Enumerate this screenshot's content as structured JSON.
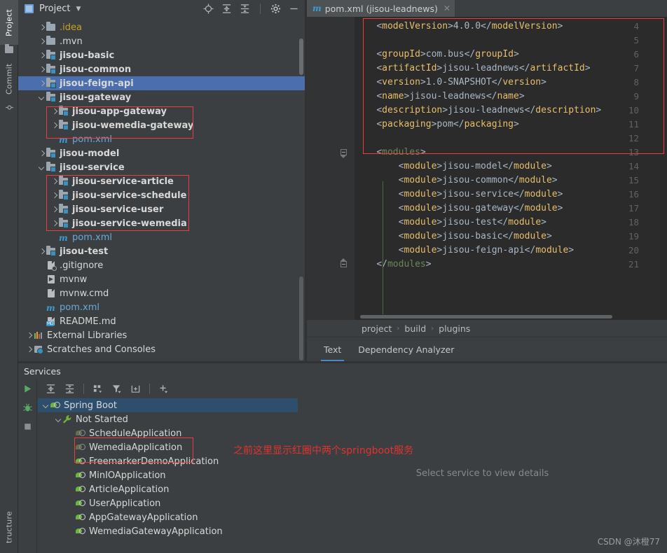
{
  "window": {
    "left_tabs": [
      {
        "label": "Project",
        "icon": "project-icon",
        "selected": true
      },
      {
        "label": "Commit",
        "icon": "commit-icon",
        "selected": false
      },
      {
        "label": "tructure",
        "icon": "structure-icon",
        "selected": false
      }
    ]
  },
  "project_panel": {
    "title": "Project",
    "dropdown_icon": "chevron-down-icon",
    "toolbar_icons": [
      "locate-icon",
      "expand-all-icon",
      "collapse-all-icon",
      "settings-gear-icon",
      "minimize-icon"
    ],
    "tree": [
      {
        "label": ".idea",
        "indent": 1,
        "arrow": "right",
        "icon": "folder-icon",
        "style": "yellow"
      },
      {
        "label": ".mvn",
        "indent": 1,
        "arrow": "right",
        "icon": "folder-icon",
        "style": "plain"
      },
      {
        "label": "jisou-basic",
        "indent": 1,
        "arrow": "right",
        "icon": "module-folder-icon",
        "style": "bold"
      },
      {
        "label": "jisou-common",
        "indent": 1,
        "arrow": "right",
        "icon": "module-folder-icon",
        "style": "bold"
      },
      {
        "label": "jisou-feign-api",
        "indent": 1,
        "arrow": "right",
        "icon": "module-folder-icon",
        "style": "bold",
        "selected": true
      },
      {
        "label": "jisou-gateway",
        "indent": 1,
        "arrow": "down",
        "icon": "module-folder-icon",
        "style": "bold"
      },
      {
        "label": "jisou-app-gateway",
        "indent": 2,
        "arrow": "right",
        "icon": "module-folder-icon",
        "style": "bold"
      },
      {
        "label": "jisou-wemedia-gateway",
        "indent": 2,
        "arrow": "right",
        "icon": "module-folder-icon",
        "style": "bold"
      },
      {
        "label": "pom.xml",
        "indent": 2,
        "arrow": "none",
        "icon": "maven-icon",
        "style": "plain"
      },
      {
        "label": "jisou-model",
        "indent": 1,
        "arrow": "right",
        "icon": "module-folder-icon",
        "style": "bold"
      },
      {
        "label": "jisou-service",
        "indent": 1,
        "arrow": "down",
        "icon": "module-folder-icon",
        "style": "bold"
      },
      {
        "label": "jisou-service-article",
        "indent": 2,
        "arrow": "right",
        "icon": "module-folder-icon",
        "style": "bold"
      },
      {
        "label": "jisou-service-schedule",
        "indent": 2,
        "arrow": "right",
        "icon": "module-folder-icon",
        "style": "bold"
      },
      {
        "label": "jisou-service-user",
        "indent": 2,
        "arrow": "right",
        "icon": "module-folder-icon",
        "style": "bold"
      },
      {
        "label": "jisou-service-wemedia",
        "indent": 2,
        "arrow": "right",
        "icon": "module-folder-icon",
        "style": "bold"
      },
      {
        "label": "pom.xml",
        "indent": 2,
        "arrow": "none",
        "icon": "maven-icon",
        "style": "plain"
      },
      {
        "label": "jisou-test",
        "indent": 1,
        "arrow": "right",
        "icon": "module-folder-icon",
        "style": "bold"
      },
      {
        "label": ".gitignore",
        "indent": 1,
        "arrow": "none",
        "icon": "gitignore-file-icon",
        "style": "plain"
      },
      {
        "label": "mvnw",
        "indent": 1,
        "arrow": "none",
        "icon": "executable-file-icon",
        "style": "plain"
      },
      {
        "label": "mvnw.cmd",
        "indent": 1,
        "arrow": "none",
        "icon": "text-file-icon",
        "style": "plain"
      },
      {
        "label": "pom.xml",
        "indent": 1,
        "arrow": "none",
        "icon": "maven-icon",
        "style": "plain"
      },
      {
        "label": "README.md",
        "indent": 1,
        "arrow": "none",
        "icon": "markdown-file-icon",
        "style": "plain"
      },
      {
        "label": "External Libraries",
        "indent": 0,
        "arrow": "right",
        "icon": "libraries-icon",
        "style": "plain"
      },
      {
        "label": "Scratches and Consoles",
        "indent": 0,
        "arrow": "right",
        "icon": "scratches-icon",
        "style": "plain"
      }
    ]
  },
  "editor": {
    "tab": {
      "label": "pom.xml (jisou-leadnews)",
      "icon": "maven-icon",
      "close_icon": "close-icon"
    },
    "lines": [
      {
        "n": "4",
        "indent": 4,
        "parts": [
          {
            "t": "<",
            "c": "brk"
          },
          {
            "t": "modelVersion",
            "c": "tag"
          },
          {
            "t": ">",
            "c": "brk"
          },
          {
            "t": "4.0.0",
            "c": "txt"
          },
          {
            "t": "</",
            "c": "brk"
          },
          {
            "t": "modelVersion",
            "c": "tag"
          },
          {
            "t": ">",
            "c": "brk"
          }
        ]
      },
      {
        "n": "5",
        "indent": 4,
        "parts": []
      },
      {
        "n": "6",
        "indent": 4,
        "parts": [
          {
            "t": "<",
            "c": "brk"
          },
          {
            "t": "groupId",
            "c": "tag"
          },
          {
            "t": ">",
            "c": "brk"
          },
          {
            "t": "com.bus",
            "c": "txt"
          },
          {
            "t": "</",
            "c": "brk"
          },
          {
            "t": "groupId",
            "c": "tag"
          },
          {
            "t": ">",
            "c": "brk"
          }
        ]
      },
      {
        "n": "7",
        "indent": 4,
        "parts": [
          {
            "t": "<",
            "c": "brk"
          },
          {
            "t": "artifactId",
            "c": "tag"
          },
          {
            "t": ">",
            "c": "brk"
          },
          {
            "t": "jisou-leadnews",
            "c": "txt"
          },
          {
            "t": "</",
            "c": "brk"
          },
          {
            "t": "artifactId",
            "c": "tag"
          },
          {
            "t": ">",
            "c": "brk"
          }
        ]
      },
      {
        "n": "8",
        "indent": 4,
        "parts": [
          {
            "t": "<",
            "c": "brk"
          },
          {
            "t": "version",
            "c": "tag"
          },
          {
            "t": ">",
            "c": "brk"
          },
          {
            "t": "1.0-SNAPSHOT",
            "c": "txt"
          },
          {
            "t": "</",
            "c": "brk"
          },
          {
            "t": "version",
            "c": "tag"
          },
          {
            "t": ">",
            "c": "brk"
          }
        ]
      },
      {
        "n": "9",
        "indent": 4,
        "parts": [
          {
            "t": "<",
            "c": "brk"
          },
          {
            "t": "name",
            "c": "tag"
          },
          {
            "t": ">",
            "c": "brk"
          },
          {
            "t": "jisou-leadnews",
            "c": "txt"
          },
          {
            "t": "</",
            "c": "brk"
          },
          {
            "t": "name",
            "c": "tag"
          },
          {
            "t": ">",
            "c": "brk"
          }
        ]
      },
      {
        "n": "10",
        "indent": 4,
        "parts": [
          {
            "t": "<",
            "c": "brk"
          },
          {
            "t": "description",
            "c": "tag"
          },
          {
            "t": ">",
            "c": "brk"
          },
          {
            "t": "jisou-leadnews",
            "c": "txt"
          },
          {
            "t": "</",
            "c": "brk"
          },
          {
            "t": "description",
            "c": "tag"
          },
          {
            "t": ">",
            "c": "brk"
          }
        ]
      },
      {
        "n": "11",
        "indent": 4,
        "parts": [
          {
            "t": "<",
            "c": "brk"
          },
          {
            "t": "packaging",
            "c": "tag"
          },
          {
            "t": ">",
            "c": "brk"
          },
          {
            "t": "pom",
            "c": "txt"
          },
          {
            "t": "</",
            "c": "brk"
          },
          {
            "t": "packaging",
            "c": "tag"
          },
          {
            "t": ">",
            "c": "brk"
          }
        ]
      },
      {
        "n": "12",
        "indent": 4,
        "parts": []
      },
      {
        "n": "13",
        "indent": 4,
        "fold": "down",
        "parts": [
          {
            "t": "<",
            "c": "brk"
          },
          {
            "t": "modules",
            "c": "green"
          },
          {
            "t": ">",
            "c": "brk"
          }
        ]
      },
      {
        "n": "14",
        "indent": 8,
        "parts": [
          {
            "t": "<",
            "c": "brk"
          },
          {
            "t": "module",
            "c": "tag"
          },
          {
            "t": ">",
            "c": "brk"
          },
          {
            "t": "jisou-model",
            "c": "txt"
          },
          {
            "t": "</",
            "c": "brk"
          },
          {
            "t": "module",
            "c": "tag"
          },
          {
            "t": ">",
            "c": "brk"
          }
        ]
      },
      {
        "n": "15",
        "indent": 8,
        "parts": [
          {
            "t": "<",
            "c": "brk"
          },
          {
            "t": "module",
            "c": "tag"
          },
          {
            "t": ">",
            "c": "brk"
          },
          {
            "t": "jisou-common",
            "c": "txt"
          },
          {
            "t": "</",
            "c": "brk"
          },
          {
            "t": "module",
            "c": "tag"
          },
          {
            "t": ">",
            "c": "brk"
          }
        ]
      },
      {
        "n": "16",
        "indent": 8,
        "parts": [
          {
            "t": "<",
            "c": "brk"
          },
          {
            "t": "module",
            "c": "tag"
          },
          {
            "t": ">",
            "c": "brk"
          },
          {
            "t": "jisou-service",
            "c": "txt"
          },
          {
            "t": "</",
            "c": "brk"
          },
          {
            "t": "module",
            "c": "tag"
          },
          {
            "t": ">",
            "c": "brk"
          }
        ]
      },
      {
        "n": "17",
        "indent": 8,
        "parts": [
          {
            "t": "<",
            "c": "brk"
          },
          {
            "t": "module",
            "c": "tag"
          },
          {
            "t": ">",
            "c": "brk"
          },
          {
            "t": "jisou-gateway",
            "c": "txt"
          },
          {
            "t": "</",
            "c": "brk"
          },
          {
            "t": "module",
            "c": "tag"
          },
          {
            "t": ">",
            "c": "brk"
          }
        ]
      },
      {
        "n": "18",
        "indent": 8,
        "parts": [
          {
            "t": "<",
            "c": "brk"
          },
          {
            "t": "module",
            "c": "tag"
          },
          {
            "t": ">",
            "c": "brk"
          },
          {
            "t": "jisou-test",
            "c": "txt"
          },
          {
            "t": "</",
            "c": "brk"
          },
          {
            "t": "module",
            "c": "tag"
          },
          {
            "t": ">",
            "c": "brk"
          }
        ]
      },
      {
        "n": "19",
        "indent": 8,
        "parts": [
          {
            "t": "<",
            "c": "brk"
          },
          {
            "t": "module",
            "c": "tag"
          },
          {
            "t": ">",
            "c": "brk"
          },
          {
            "t": "jisou-basic",
            "c": "txt"
          },
          {
            "t": "</",
            "c": "brk"
          },
          {
            "t": "module",
            "c": "tag"
          },
          {
            "t": ">",
            "c": "brk"
          }
        ]
      },
      {
        "n": "20",
        "indent": 8,
        "parts": [
          {
            "t": "<",
            "c": "brk"
          },
          {
            "t": "module",
            "c": "tag"
          },
          {
            "t": ">",
            "c": "brk"
          },
          {
            "t": "jisou-feign-api",
            "c": "txt"
          },
          {
            "t": "</",
            "c": "brk"
          },
          {
            "t": "module",
            "c": "tag"
          },
          {
            "t": ">",
            "c": "brk"
          }
        ]
      },
      {
        "n": "21",
        "indent": 4,
        "fold": "up",
        "parts": [
          {
            "t": "</",
            "c": "brk"
          },
          {
            "t": "modules",
            "c": "green"
          },
          {
            "t": ">",
            "c": "brk"
          }
        ]
      }
    ],
    "breadcrumb": [
      "project",
      "build",
      "plugins"
    ],
    "bottom_tabs": [
      {
        "label": "Text",
        "active": true
      },
      {
        "label": "Dependency Analyzer",
        "active": false
      }
    ]
  },
  "services": {
    "title": "Services",
    "gutter_icons": [
      "run-icon",
      "debug-icon",
      "stop-icon"
    ],
    "toolbar_icons": [
      "expand-all-icon",
      "collapse-all-icon",
      "group-by-icon",
      "filter-icon",
      "add-tab-icon",
      "add-icon"
    ],
    "tree": [
      {
        "label": "Spring Boot",
        "indent": 0,
        "arrow": "down",
        "icon": "spring-boot-icon",
        "selected": true
      },
      {
        "label": "Not Started",
        "indent": 1,
        "arrow": "down",
        "icon": "wrench-icon"
      },
      {
        "label": "ScheduleApplication",
        "indent": 2,
        "arrow": "none",
        "icon": "spring-boot-icon",
        "dim": true
      },
      {
        "label": "WemediaApplication",
        "indent": 2,
        "arrow": "none",
        "icon": "spring-boot-icon",
        "dim": true
      },
      {
        "label": "FreemarkerDemoApplication",
        "indent": 2,
        "arrow": "none",
        "icon": "spring-boot-icon"
      },
      {
        "label": "MinIOApplication",
        "indent": 2,
        "arrow": "none",
        "icon": "spring-boot-icon"
      },
      {
        "label": "ArticleApplication",
        "indent": 2,
        "arrow": "none",
        "icon": "spring-boot-icon"
      },
      {
        "label": "UserApplication",
        "indent": 2,
        "arrow": "none",
        "icon": "spring-boot-icon"
      },
      {
        "label": "AppGatewayApplication",
        "indent": 2,
        "arrow": "none",
        "icon": "spring-boot-icon"
      },
      {
        "label": "WemediaGatewayApplication",
        "indent": 2,
        "arrow": "none",
        "icon": "spring-boot-icon"
      }
    ],
    "empty_message": "Select service to view details"
  },
  "annotations": {
    "note_text": "之前这里显示红圈中两个springboot服务",
    "note_color": "#e0332f",
    "highlight_color": "#ef3b3b"
  },
  "watermark": "CSDN @沐橙77",
  "colors": {
    "panel_bg": "#3c3f41",
    "editor_bg": "#2b2b2b",
    "selection_blue": "#4b6eaf",
    "services_selection": "#2d4f6c",
    "accent": "#4a88c7",
    "xml_tag": "#e8bf6a",
    "xml_text": "#a9b7c6",
    "xml_special": "#6a8759"
  }
}
